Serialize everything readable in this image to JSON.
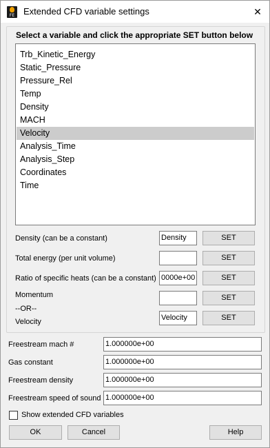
{
  "window": {
    "title": "Extended CFD variable settings",
    "close_glyph": "✕",
    "app_icon_text": "FE"
  },
  "group": {
    "title": "Select a variable and click the appropriate SET button below"
  },
  "variables": [
    "Trb_Kinetic_Energy",
    "Static_Pressure",
    "Pressure_Rel",
    "Temp",
    "Density",
    "MACH",
    "Velocity",
    "Analysis_Time",
    "Analysis_Step",
    "Coordinates",
    "Time"
  ],
  "selected_variable": "Velocity",
  "fields": {
    "density": {
      "label": "Density (can be a constant)",
      "value": "Density",
      "button": "SET"
    },
    "total_energy": {
      "label": "Total energy (per unit volume)",
      "value": "",
      "button": "SET"
    },
    "ratio_specific_heats": {
      "label": "Ratio of specific heats (can be a constant)",
      "value": "0000e+00",
      "button": "SET"
    },
    "momentum": {
      "label": "Momentum",
      "value": "",
      "button": "SET"
    },
    "or_label": "--OR--",
    "velocity": {
      "label": "Velocity",
      "value": "Velocity",
      "button": "SET"
    }
  },
  "constants": {
    "freestream_mach": {
      "label": "Freestream mach #",
      "value": "1.000000e+00"
    },
    "gas_constant": {
      "label": "Gas constant",
      "value": "1.000000e+00"
    },
    "freestream_density": {
      "label": "Freestream density",
      "value": "1.000000e+00"
    },
    "freestream_speed_of_sound": {
      "label": "Freestream speed of sound",
      "value": "1.000000e+00"
    }
  },
  "show_extended": {
    "label": "Show extended CFD variables",
    "checked": false
  },
  "buttons": {
    "ok": "OK",
    "cancel": "Cancel",
    "help": "Help"
  },
  "colors": {
    "window_bg": "#f0f0f0",
    "selection": "#cccccc",
    "button_bg": "#e1e1e1"
  }
}
